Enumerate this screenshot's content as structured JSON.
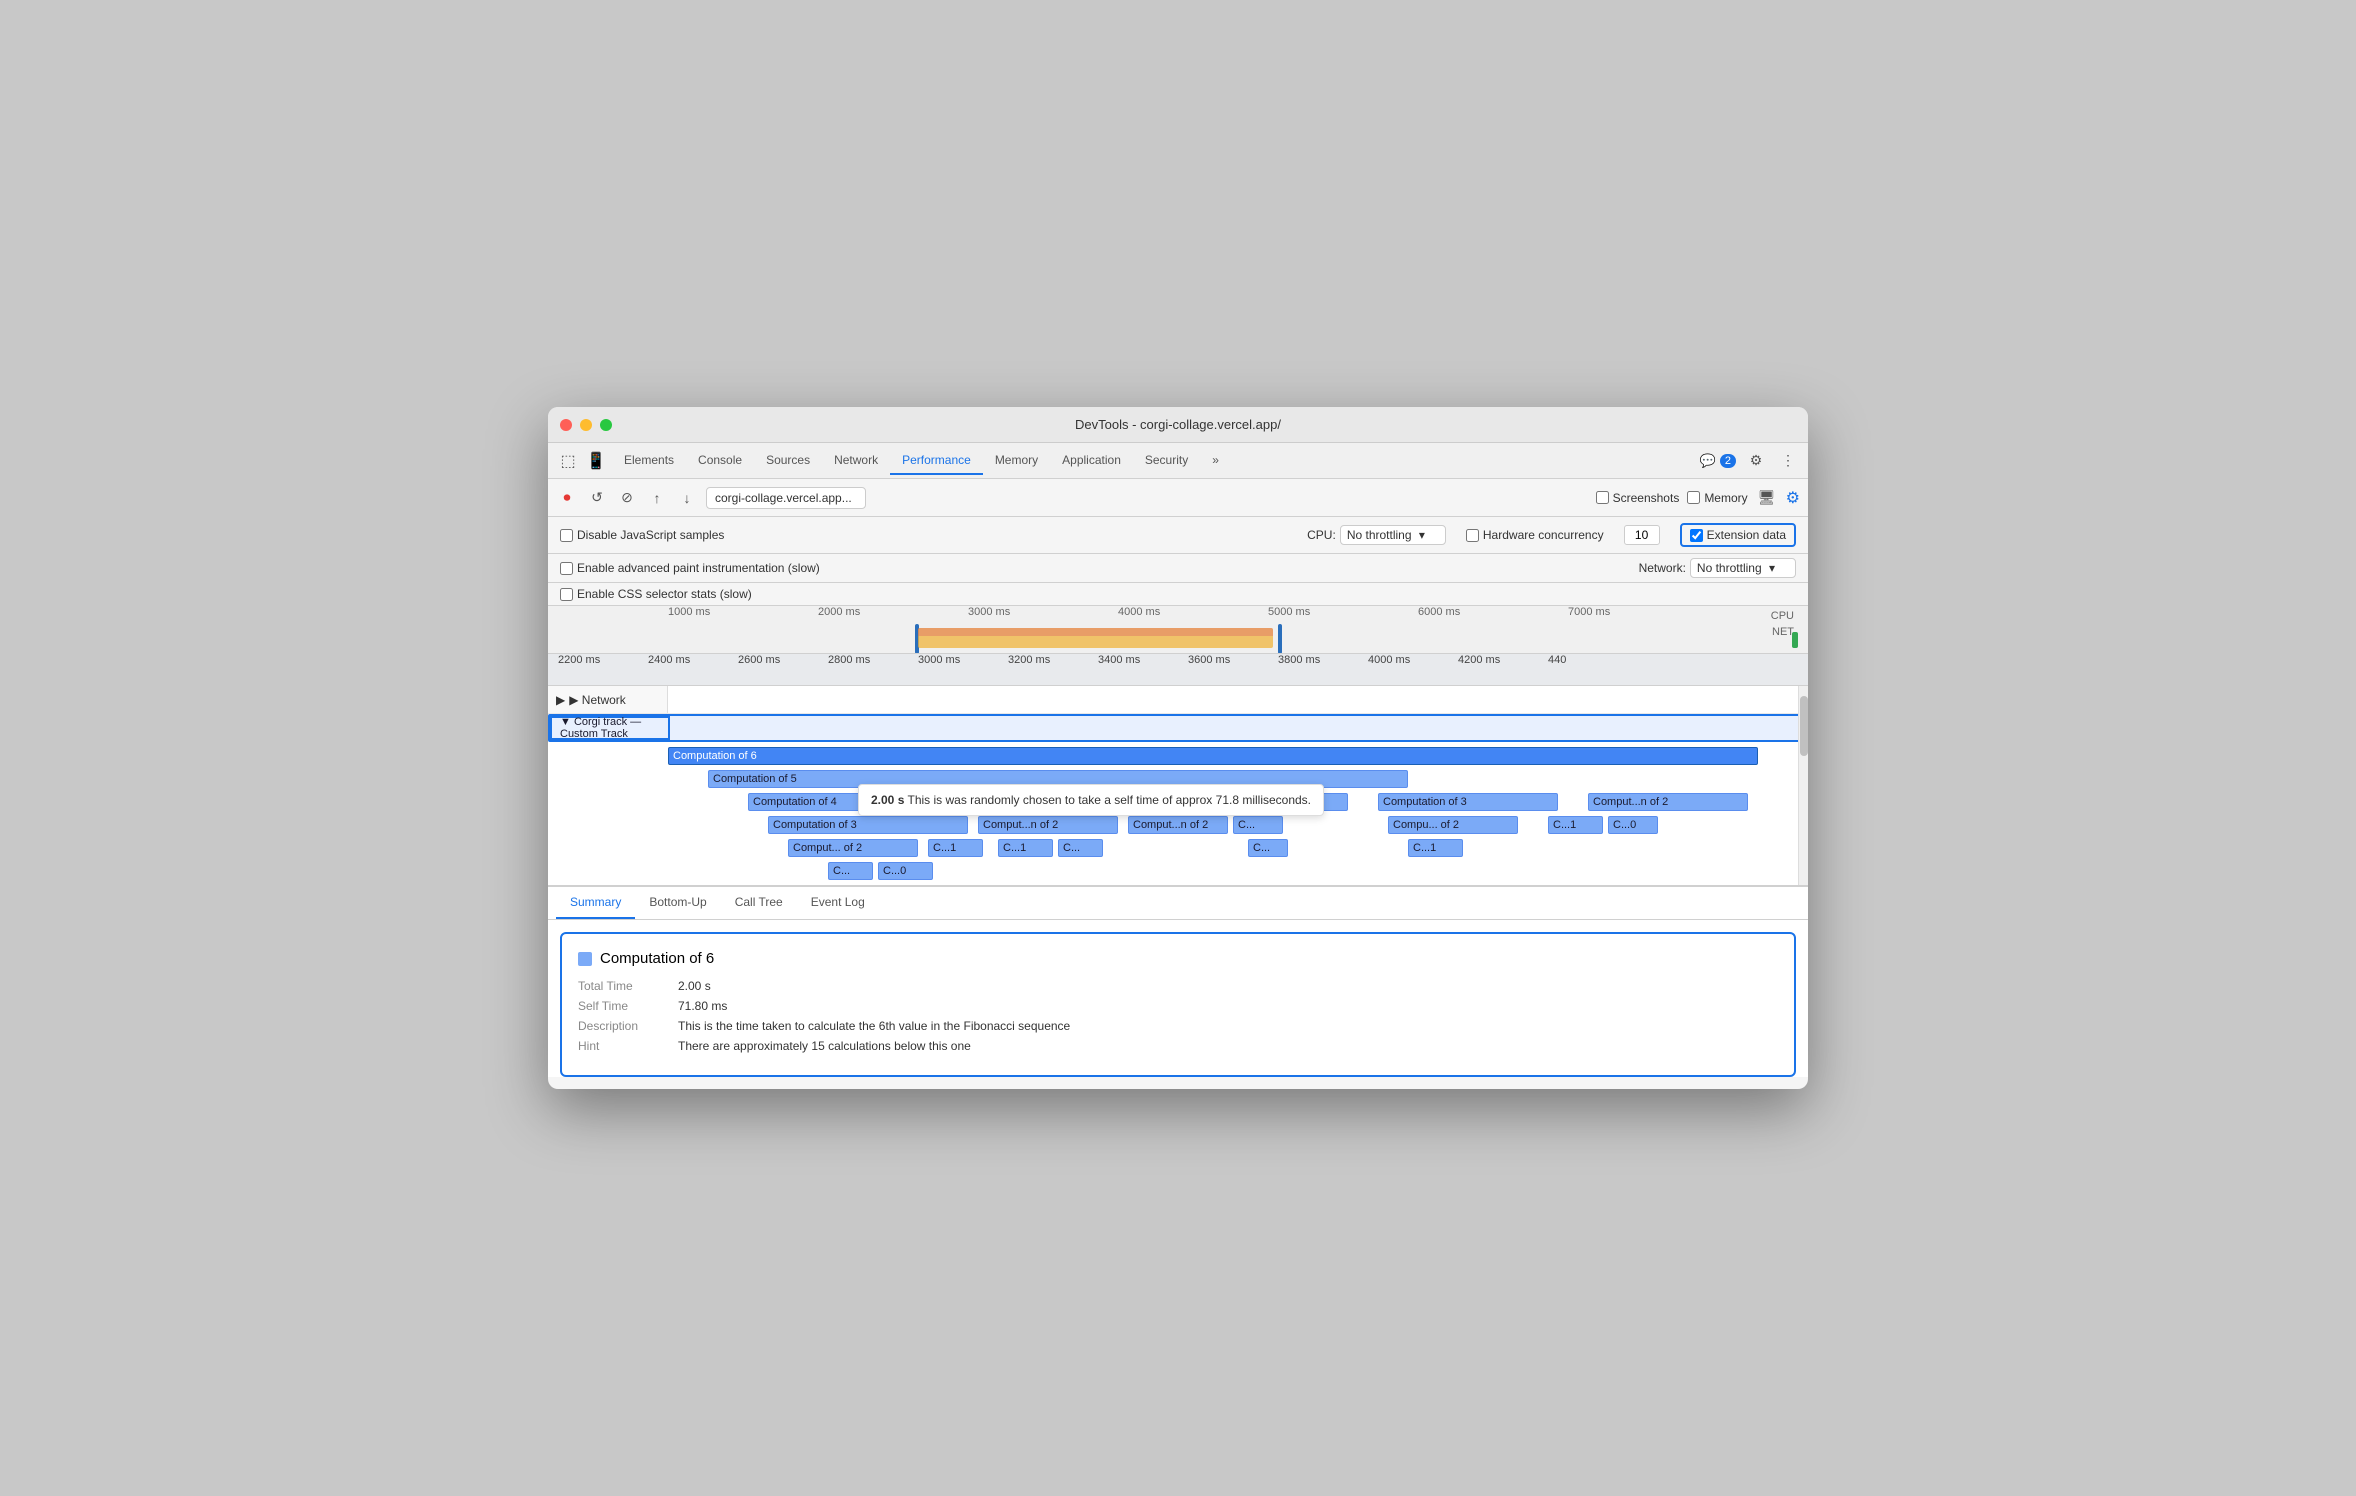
{
  "window": {
    "title": "DevTools - corgi-collage.vercel.app/"
  },
  "tabs": [
    {
      "label": "Elements",
      "active": false
    },
    {
      "label": "Console",
      "active": false
    },
    {
      "label": "Sources",
      "active": false
    },
    {
      "label": "Network",
      "active": false
    },
    {
      "label": "Performance",
      "active": true
    },
    {
      "label": "Memory",
      "active": false
    },
    {
      "label": "Application",
      "active": false
    },
    {
      "label": "Security",
      "active": false
    },
    {
      "label": "»",
      "active": false
    }
  ],
  "toolbar": {
    "message_badge": "2",
    "url": "corgi-collage.vercel.app..."
  },
  "secondary_toolbar": {
    "screenshots_label": "Screenshots",
    "memory_label": "Memory"
  },
  "settings": {
    "disable_js_samples": "Disable JavaScript samples",
    "enable_paint": "Enable advanced paint instrumentation (slow)",
    "enable_css": "Enable CSS selector stats (slow)",
    "cpu_label": "CPU:",
    "cpu_value": "No throttling",
    "network_label": "Network:",
    "network_value": "No throttling",
    "hw_concurrency_label": "Hardware concurrency",
    "hw_concurrency_value": "10",
    "extension_data_label": "Extension data"
  },
  "timeline": {
    "ruler_top": [
      "1000 ms",
      "2000 ms",
      "3000 ms",
      "4000 ms",
      "5000 ms",
      "6000 ms",
      "7000 ms"
    ],
    "ruler_bottom": [
      "2200 ms",
      "2400 ms",
      "2600 ms",
      "2800 ms",
      "3000 ms",
      "3200 ms",
      "3400 ms",
      "3600 ms",
      "3800 ms",
      "4000 ms",
      "4200 ms",
      "440"
    ],
    "cpu_label": "CPU",
    "net_label": "NET"
  },
  "tracks": {
    "network_label": "▶ Network",
    "corgi_label": "▼ Corgi track — Custom Track"
  },
  "flame": {
    "row1": [
      {
        "label": "Computation of 6",
        "selected": true
      }
    ],
    "row2": [
      {
        "label": "Computation of 5",
        "selected": false
      }
    ],
    "row3": [
      {
        "label": "Computation of 4"
      },
      {
        "label": "Computation of 3"
      },
      {
        "label": "Computation of 3"
      },
      {
        "label": "Comput...n of 2"
      }
    ],
    "row4": [
      {
        "label": "Computation of 3"
      },
      {
        "label": "Comput...n of 2"
      },
      {
        "label": "Comput...n of 2"
      },
      {
        "label": "C..."
      },
      {
        "label": "Compu... of 2"
      },
      {
        "label": "C...1"
      },
      {
        "label": "C...0"
      }
    ],
    "row5": [
      {
        "label": "Comput... of 2"
      },
      {
        "label": "C...1"
      },
      {
        "label": "C...1"
      },
      {
        "label": "C..."
      },
      {
        "label": "C..."
      },
      {
        "label": "C...1"
      }
    ],
    "row6": [
      {
        "label": "C..."
      },
      {
        "label": "C...0"
      }
    ]
  },
  "tooltip": {
    "time": "2.00 s",
    "text": "This is was randomly chosen to take a self time of approx 71.8 milliseconds."
  },
  "bottom_tabs": [
    "Summary",
    "Bottom-Up",
    "Call Tree",
    "Event Log"
  ],
  "summary": {
    "title": "Computation of 6",
    "color": "#7baaf7",
    "rows": [
      {
        "key": "Total Time",
        "value": "2.00 s"
      },
      {
        "key": "Self Time",
        "value": "71.80 ms"
      },
      {
        "key": "Description",
        "value": "This is the time taken to calculate the 6th value in the Fibonacci sequence"
      },
      {
        "key": "Hint",
        "value": "There are approximately 15 calculations below this one"
      }
    ]
  }
}
